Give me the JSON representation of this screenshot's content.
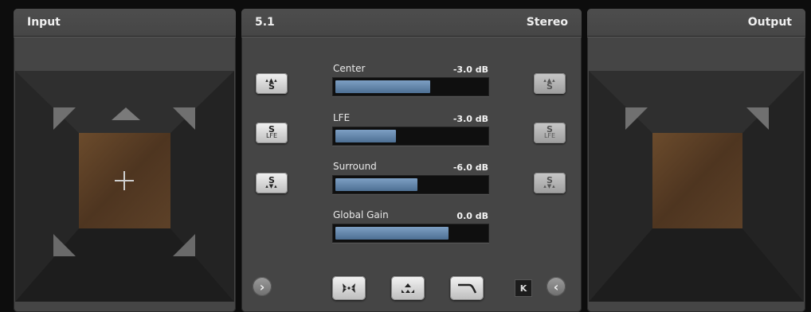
{
  "input_panel": {
    "title": "Input"
  },
  "middle_panel": {
    "title_left": "5.1",
    "title_right": "Stereo",
    "sliders": [
      {
        "label": "Center",
        "value_text": "-3.0 dB",
        "fill": 0.64
      },
      {
        "label": "LFE",
        "value_text": "-3.0 dB",
        "fill": 0.42
      },
      {
        "label": "Surround",
        "value_text": "-6.0 dB",
        "fill": 0.56
      },
      {
        "label": "Global Gain",
        "value_text": "0.0 dB",
        "fill": 0.76
      }
    ],
    "left_buttons": [
      {
        "icon": "speaker-front-s-icon",
        "top_text": "▴▲▴",
        "letter": "S"
      },
      {
        "icon": "speaker-s-lfe-icon",
        "letter": "S",
        "sub": "LFE"
      },
      {
        "icon": "speaker-rear-s-icon",
        "letter": "S",
        "bottom_text": "▴▼▴"
      }
    ],
    "right_buttons": [
      {
        "icon": "speaker-front-s-icon",
        "top_text": "▴▲▴",
        "letter": "S"
      },
      {
        "icon": "speaker-s-lfe-icon",
        "letter": "S",
        "sub": "LFE"
      },
      {
        "icon": "speaker-rear-s-icon",
        "letter": "S",
        "bottom_text": "▴▼▴"
      }
    ],
    "bottom": {
      "left_arrow": "›",
      "right_arrow": "‹",
      "skip_label": "K"
    }
  },
  "output_panel": {
    "title": "Output"
  },
  "colors": {
    "accent": "#5f83aa",
    "panel": "#454545",
    "floor": "#5a3f26"
  }
}
